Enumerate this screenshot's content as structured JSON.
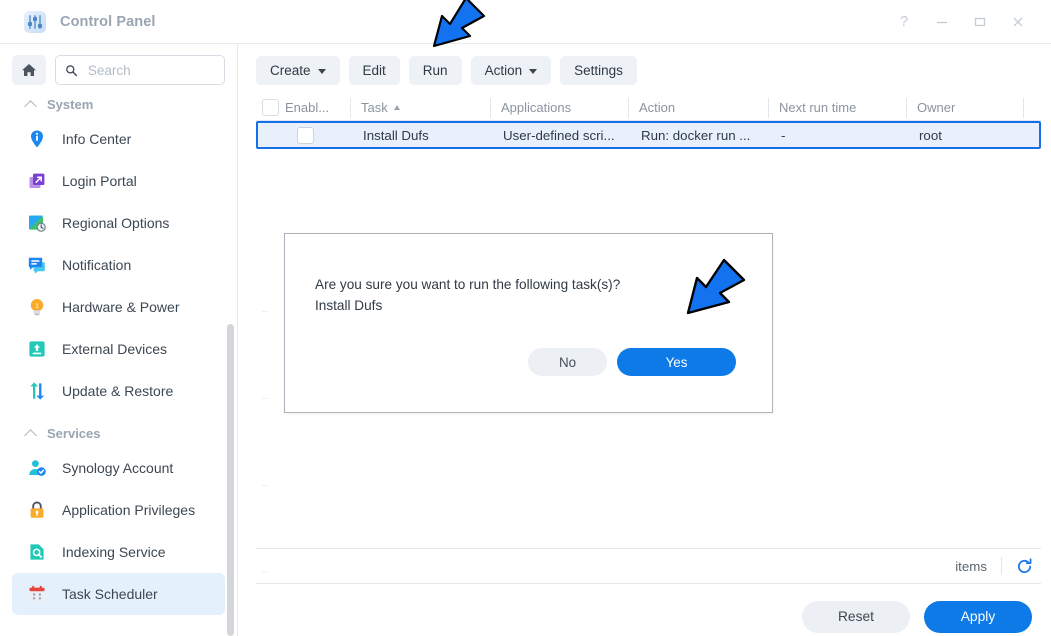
{
  "window": {
    "title": "Control Panel",
    "app_icon": "control-panel-icon",
    "controls": [
      {
        "name": "help-button",
        "glyph": "?"
      },
      {
        "name": "minimize-button",
        "glyph": "–"
      },
      {
        "name": "maximize-button",
        "glyph": "□"
      },
      {
        "name": "close-button",
        "glyph": "✕"
      }
    ]
  },
  "sidebar": {
    "home_icon": "home-icon",
    "search": {
      "placeholder": "Search",
      "value": "",
      "icon": "search-icon"
    },
    "groups": [
      {
        "label": "System",
        "expanded": true,
        "items": [
          {
            "label": "Info Center",
            "icon": "info-center-icon"
          },
          {
            "label": "Login Portal",
            "icon": "login-portal-icon"
          },
          {
            "label": "Regional Options",
            "icon": "regional-options-icon"
          },
          {
            "label": "Notification",
            "icon": "notification-icon"
          },
          {
            "label": "Hardware & Power",
            "icon": "hardware-power-icon"
          },
          {
            "label": "External Devices",
            "icon": "external-devices-icon"
          },
          {
            "label": "Update & Restore",
            "icon": "update-restore-icon"
          }
        ]
      },
      {
        "label": "Services",
        "expanded": true,
        "items": [
          {
            "label": "Synology Account",
            "icon": "synology-account-icon"
          },
          {
            "label": "Application Privileges",
            "icon": "application-privileges-icon"
          },
          {
            "label": "Indexing Service",
            "icon": "indexing-service-icon"
          },
          {
            "label": "Task Scheduler",
            "icon": "task-scheduler-icon",
            "active": true
          }
        ]
      }
    ]
  },
  "toolbar": {
    "buttons": [
      {
        "label": "Create",
        "dropdown": true
      },
      {
        "label": "Edit",
        "dropdown": false
      },
      {
        "label": "Run",
        "dropdown": false
      },
      {
        "label": "Action",
        "dropdown": true
      },
      {
        "label": "Settings",
        "dropdown": false
      }
    ]
  },
  "table": {
    "columns": [
      {
        "key": "enable",
        "label": "Enabl...",
        "sorted": false
      },
      {
        "key": "task",
        "label": "Task",
        "sorted": true
      },
      {
        "key": "apps",
        "label": "Applications",
        "sorted": false
      },
      {
        "key": "action",
        "label": "Action",
        "sorted": false
      },
      {
        "key": "next",
        "label": "Next run time",
        "sorted": false
      },
      {
        "key": "owner",
        "label": "Owner",
        "sorted": false
      }
    ],
    "rows": [
      {
        "enabled": false,
        "task": "Install Dufs",
        "apps": "User-defined scri...",
        "action": "Run: docker run ...",
        "next": "-",
        "owner": "root",
        "selected": true
      }
    ]
  },
  "status": {
    "items_label": "items",
    "refresh_icon": "refresh-icon"
  },
  "footer": {
    "reset_label": "Reset",
    "apply_label": "Apply"
  },
  "dialog": {
    "message_line1": "Are you sure you want to run the following task(s)?",
    "message_line2": "Install Dufs",
    "no_label": "No",
    "yes_label": "Yes"
  },
  "annotations": {
    "arrow_color": "#1272f0",
    "arrows": [
      {
        "name": "arrow-pointing-to-run-button",
        "target": "Run"
      },
      {
        "name": "arrow-pointing-to-yes-button",
        "target": "Yes"
      }
    ]
  },
  "colors": {
    "accent": "#0d7ae8",
    "selection_border": "#1570e8",
    "selection_fill": "#e8f1fb",
    "sidebar_active": "#e4f0fb",
    "toolbar_button": "#eef1f6",
    "arrow": "#1272f0"
  }
}
